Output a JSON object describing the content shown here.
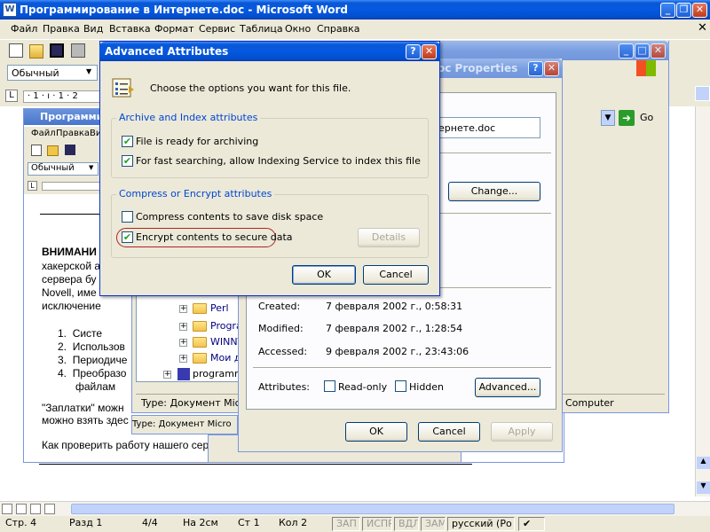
{
  "word": {
    "title": "Программирование в Интернете.doc - Microsoft Word",
    "menu": [
      "Файл",
      "Правка",
      "Вид",
      "Вставка",
      "Формат",
      "Сервис",
      "Таблица",
      "Окно",
      "Справка"
    ],
    "style_box": "Обычный",
    "ruler_text": "· 1 · ı · 1 · 2",
    "inner_title": "Программирование",
    "inner_menu": [
      "Файл",
      "Правка",
      "Ви"
    ],
    "inner_style_box": "Обычный",
    "doc": {
      "heading": "ВНИМАНИ",
      "lines": [
        "хакерской а",
        "сервера бу",
        "Novell, име",
        "исключение"
      ],
      "list": [
        "Систе",
        "Использов",
        "Периодиче",
        "Преобразо"
      ],
      "list_cont": "файлам",
      "para2_a": "\"Заплатки\" можн",
      "para2_b": "можно взять здес",
      "para3": "Как проверить работу нашего сер"
    },
    "status": {
      "page": "Стр. 4",
      "section": "Разд 1",
      "pages": "4/4",
      "at": "На 2см",
      "line": "Ст 1",
      "col": "Кол 2",
      "rec": "ЗАП",
      "trk": "ИСПР",
      "ext": "ВДЛ",
      "ovr": "ЗАМ",
      "lang": "русский (Ро"
    }
  },
  "explorer": {
    "go_label": "Go",
    "tree": [
      "Perl",
      "Progra",
      "WINNT",
      "Мои д",
      "programm"
    ],
    "status_type": "Type: Документ Micro",
    "status_type2": "Type: Документ Micro",
    "computer": "Computer"
  },
  "properties": {
    "title": "oc Properties",
    "filename": "ернете.doc",
    "change_button": "Change...",
    "created_label": "Created:",
    "created_value": "7 февраля 2002 г., 0:58:31",
    "modified_label": "Modified:",
    "modified_value": "7 февраля 2002 г., 1:28:54",
    "accessed_label": "Accessed:",
    "accessed_value": "9 февраля 2002 г., 23:43:06",
    "attributes_label": "Attributes:",
    "readonly_label": "Read-only",
    "hidden_label": "Hidden",
    "advanced_button": "Advanced...",
    "ok": "OK",
    "cancel": "Cancel",
    "apply": "Apply"
  },
  "advanced": {
    "title": "Advanced Attributes",
    "intro": "Choose the options you want for this file.",
    "archive_group": "Archive and Index attributes",
    "archive_label": "File is ready for archiving",
    "archive_checked": true,
    "index_label": "For fast searching, allow Indexing Service to index this file",
    "index_checked": true,
    "compress_group": "Compress or Encrypt attributes",
    "compress_label": "Compress contents to save disk space",
    "compress_checked": false,
    "encrypt_label": "Encrypt contents to secure data",
    "encrypt_checked": true,
    "details_button": "Details",
    "ok": "OK",
    "cancel": "Cancel",
    "highlight_color": "#b22222"
  }
}
